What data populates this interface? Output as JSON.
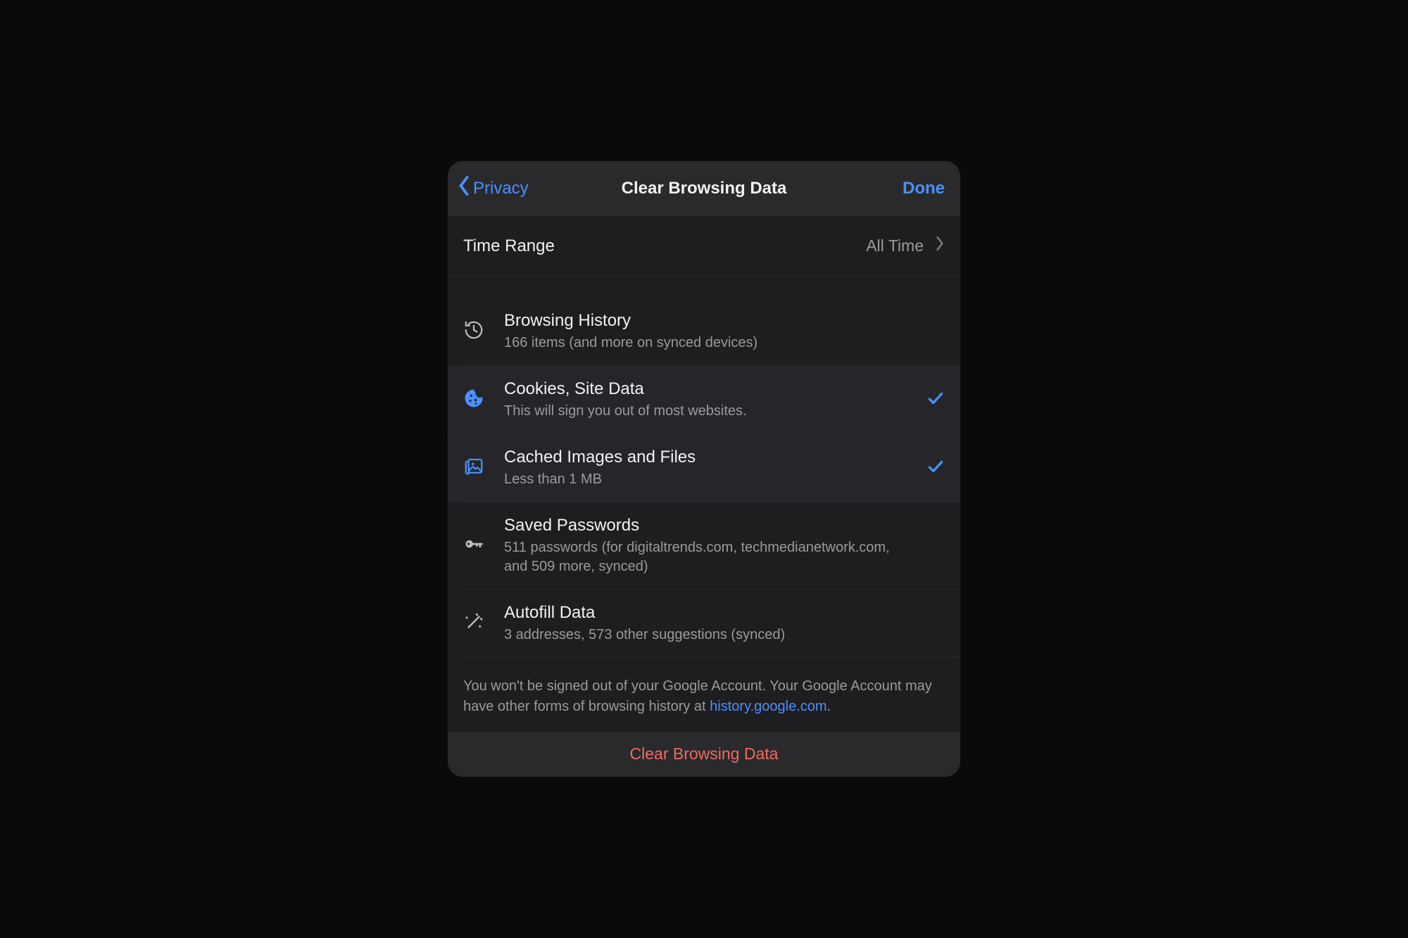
{
  "navbar": {
    "back_label": "Privacy",
    "title": "Clear Browsing Data",
    "done_label": "Done"
  },
  "time_range": {
    "label": "Time Range",
    "value": "All Time"
  },
  "options": [
    {
      "icon": "history-icon",
      "title": "Browsing History",
      "subtitle": "166 items (and more on synced devices)",
      "selected": false
    },
    {
      "icon": "cookie-icon",
      "title": "Cookies, Site Data",
      "subtitle": "This will sign you out of most websites.",
      "selected": true
    },
    {
      "icon": "cache-icon",
      "title": "Cached Images and Files",
      "subtitle": "Less than 1 MB",
      "selected": true
    },
    {
      "icon": "key-icon",
      "title": "Saved Passwords",
      "subtitle": "511 passwords (for digitaltrends.com, techmedianetwork.com, and 509 more, synced)",
      "selected": false
    },
    {
      "icon": "wand-icon",
      "title": "Autofill Data",
      "subtitle": "3 addresses, 573 other suggestions (synced)",
      "selected": false
    }
  ],
  "footer": {
    "text_before": "You won't be signed out of your Google Account. Your Google Account may have other forms of browsing history at ",
    "link_text": "history.google.com",
    "text_after": "."
  },
  "action": {
    "label": "Clear Browsing Data"
  }
}
